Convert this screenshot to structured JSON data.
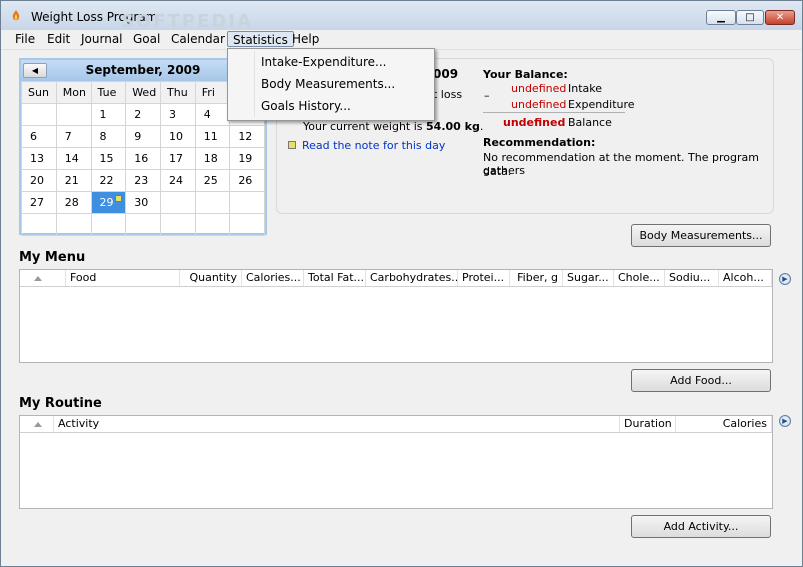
{
  "window": {
    "title": "Weight Loss Program",
    "watermark": "SOFTPEDIA"
  },
  "menubar": {
    "items": [
      "File",
      "Edit",
      "Journal",
      "Goal",
      "Calendar",
      "Statistics",
      "Help"
    ]
  },
  "statistics_menu": {
    "items": [
      "Intake-Expenditure...",
      "Body Measurements...",
      "Goals History..."
    ]
  },
  "calendar": {
    "prev": "◀",
    "month": "September, 2009",
    "days": [
      "Sun",
      "Mon",
      "Tue",
      "Wed",
      "Thu",
      "Fri",
      "Sat"
    ],
    "weeks": [
      [
        "",
        "",
        "1",
        "2",
        "3",
        "4",
        ""
      ],
      [
        "6",
        "7",
        "8",
        "9",
        "10",
        "11",
        "12"
      ],
      [
        "13",
        "14",
        "15",
        "16",
        "17",
        "18",
        "19"
      ],
      [
        "20",
        "21",
        "22",
        "23",
        "24",
        "25",
        "26"
      ],
      [
        "27",
        "28",
        "29",
        "30",
        "",
        "",
        ""
      ],
      [
        "",
        "",
        "",
        "",
        "",
        "",
        ""
      ]
    ],
    "selected_day": "29"
  },
  "info": {
    "year_fragment": "009",
    "loss_fragment": "t loss",
    "current_weight_prefix": "Your current weight is",
    "current_weight_value": "54.00 kg",
    "current_weight_suffix": ".",
    "note_link": "Read the note for this day"
  },
  "balance": {
    "title": "Your Balance:",
    "intake_value": "undefined",
    "intake_label": "Intake",
    "minus_sign": "–",
    "expenditure_value": "undefined",
    "expenditure_label": "Expenditure",
    "balance_value": "undefined",
    "balance_label": "Balance"
  },
  "recommendation": {
    "title": "Recommendation:",
    "text_line1": "No recommendation at the moment. The program gathers",
    "text_line2": "data."
  },
  "buttons": {
    "body_measurements": "Body Measurements...",
    "add_food": "Add Food...",
    "add_activity": "Add Activity..."
  },
  "menu_section": {
    "title": "My Menu",
    "columns": [
      "Food",
      "Quantity",
      "Calories...",
      "Total Fat...",
      "Carbohydrates...",
      "Protei...",
      "Fiber, g",
      "Sugar...",
      "Chole...",
      "Sodiu...",
      "Alcoh..."
    ]
  },
  "routine_section": {
    "title": "My Routine",
    "columns": [
      "Activity",
      "Duration",
      "Calories"
    ]
  },
  "colors": {
    "accent": "#3f8fe0",
    "undefined_red": "#c00000",
    "link_blue": "#0033cc"
  }
}
